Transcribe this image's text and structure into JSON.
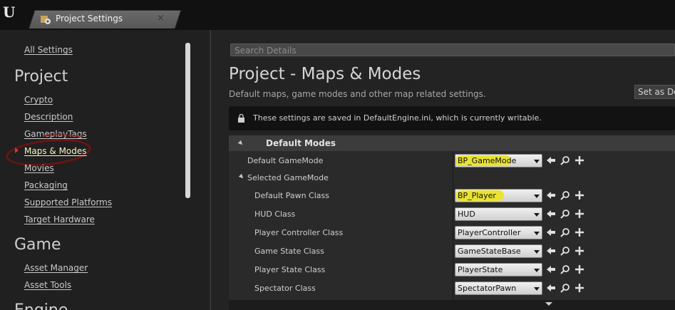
{
  "window": {
    "tab_title": "Project Settings",
    "close_glyph": "×"
  },
  "search": {
    "placeholder": "Search Details"
  },
  "sidebar": {
    "all_settings": "All Settings",
    "sections": [
      {
        "title": "Project",
        "items": [
          "Crypto",
          "Description",
          "GameplayTags",
          "Maps & Modes",
          "Movies",
          "Packaging",
          "Supported Platforms",
          "Target Hardware"
        ]
      },
      {
        "title": "Game",
        "items": [
          "Asset Manager",
          "Asset Tools"
        ]
      },
      {
        "title": "Engine",
        "items": []
      }
    ],
    "active_item": "Maps & Modes"
  },
  "main": {
    "title": "Project - Maps & Modes",
    "description": "Default maps, game modes and other map related settings.",
    "set_default_label": "Set as Default",
    "notice": "These settings are saved in DefaultEngine.ini, which is currently writable.",
    "category": "Default Modes",
    "default_gamemode_label": "Default GameMode",
    "default_gamemode_value": "BP_GameMode",
    "selected_gamemode_label": "Selected GameMode",
    "rows": [
      {
        "label": "Default Pawn Class",
        "value": "BP_Player",
        "highlighted": true
      },
      {
        "label": "HUD Class",
        "value": "HUD",
        "highlighted": false
      },
      {
        "label": "Player Controller Class",
        "value": "PlayerController",
        "highlighted": false
      },
      {
        "label": "Game State Class",
        "value": "GameStateBase",
        "highlighted": false
      },
      {
        "label": "Player State Class",
        "value": "PlayerState",
        "highlighted": false
      },
      {
        "label": "Spectator Class",
        "value": "SpectatorPawn",
        "highlighted": false
      }
    ]
  },
  "colors": {
    "highlight_yellow": "#e9e32a",
    "annotation_red": "#6b1414",
    "active_arrow": "#d23a3a"
  },
  "icons": {
    "logo": "unreal-logo-icon",
    "tab": "settings-gear-icon",
    "notice": "lock-icon",
    "row_actions": [
      "use-selected-arrow-icon",
      "browse-search-icon",
      "add-plus-icon"
    ]
  }
}
